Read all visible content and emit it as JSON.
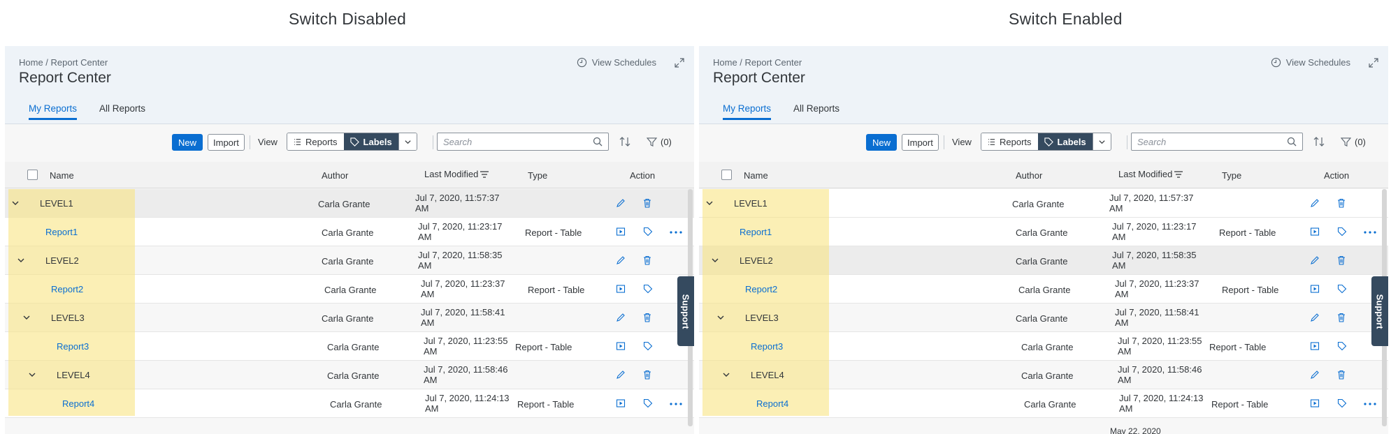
{
  "captions": {
    "left": "Switch Disabled",
    "right": "Switch Enabled"
  },
  "shell": {
    "breadcrumb": "Home / Report Center",
    "title": "Report Center",
    "view_schedules": "View Schedules"
  },
  "tabs": [
    {
      "label": "My Reports"
    },
    {
      "label": "All Reports"
    }
  ],
  "toolbar": {
    "new_label": "New",
    "import_label": "Import",
    "view_label": "View",
    "reports_label": "Reports",
    "labels_label": "Labels",
    "search_placeholder": "Search",
    "filter_count": "(0)"
  },
  "columns": {
    "name": "Name",
    "author": "Author",
    "modified": "Last Modified",
    "type": "Type",
    "action": "Action"
  },
  "rows": [
    {
      "name": "LEVEL1",
      "author": "Carla Grante",
      "modified": "Jul 7, 2020, 11:57:37 AM",
      "type": ""
    },
    {
      "name": "Report1",
      "author": "Carla Grante",
      "modified": "Jul 7, 2020, 11:23:17 AM",
      "type": "Report - Table"
    },
    {
      "name": "LEVEL2",
      "author": "Carla Grante",
      "modified": "Jul 7, 2020, 11:58:35 AM",
      "type": ""
    },
    {
      "name": "Report2",
      "author": "Carla Grante",
      "modified": "Jul 7, 2020, 11:23:37 AM",
      "type": "Report - Table"
    },
    {
      "name": "LEVEL3",
      "author": "Carla Grante",
      "modified": "Jul 7, 2020, 11:58:41 AM",
      "type": ""
    },
    {
      "name": "Report3",
      "author": "Carla Grante",
      "modified": "Jul 7, 2020, 11:23:55 AM",
      "type": "Report - Table"
    },
    {
      "name": "LEVEL4",
      "author": "Carla Grante",
      "modified": "Jul 7, 2020, 11:58:46 AM",
      "type": ""
    },
    {
      "name": "Report4",
      "author": "Carla Grante",
      "modified": "Jul 7, 2020, 11:24:13 AM",
      "type": "Report - Table"
    }
  ],
  "support_label": "Support",
  "footer_peek": "May 22, 2020"
}
